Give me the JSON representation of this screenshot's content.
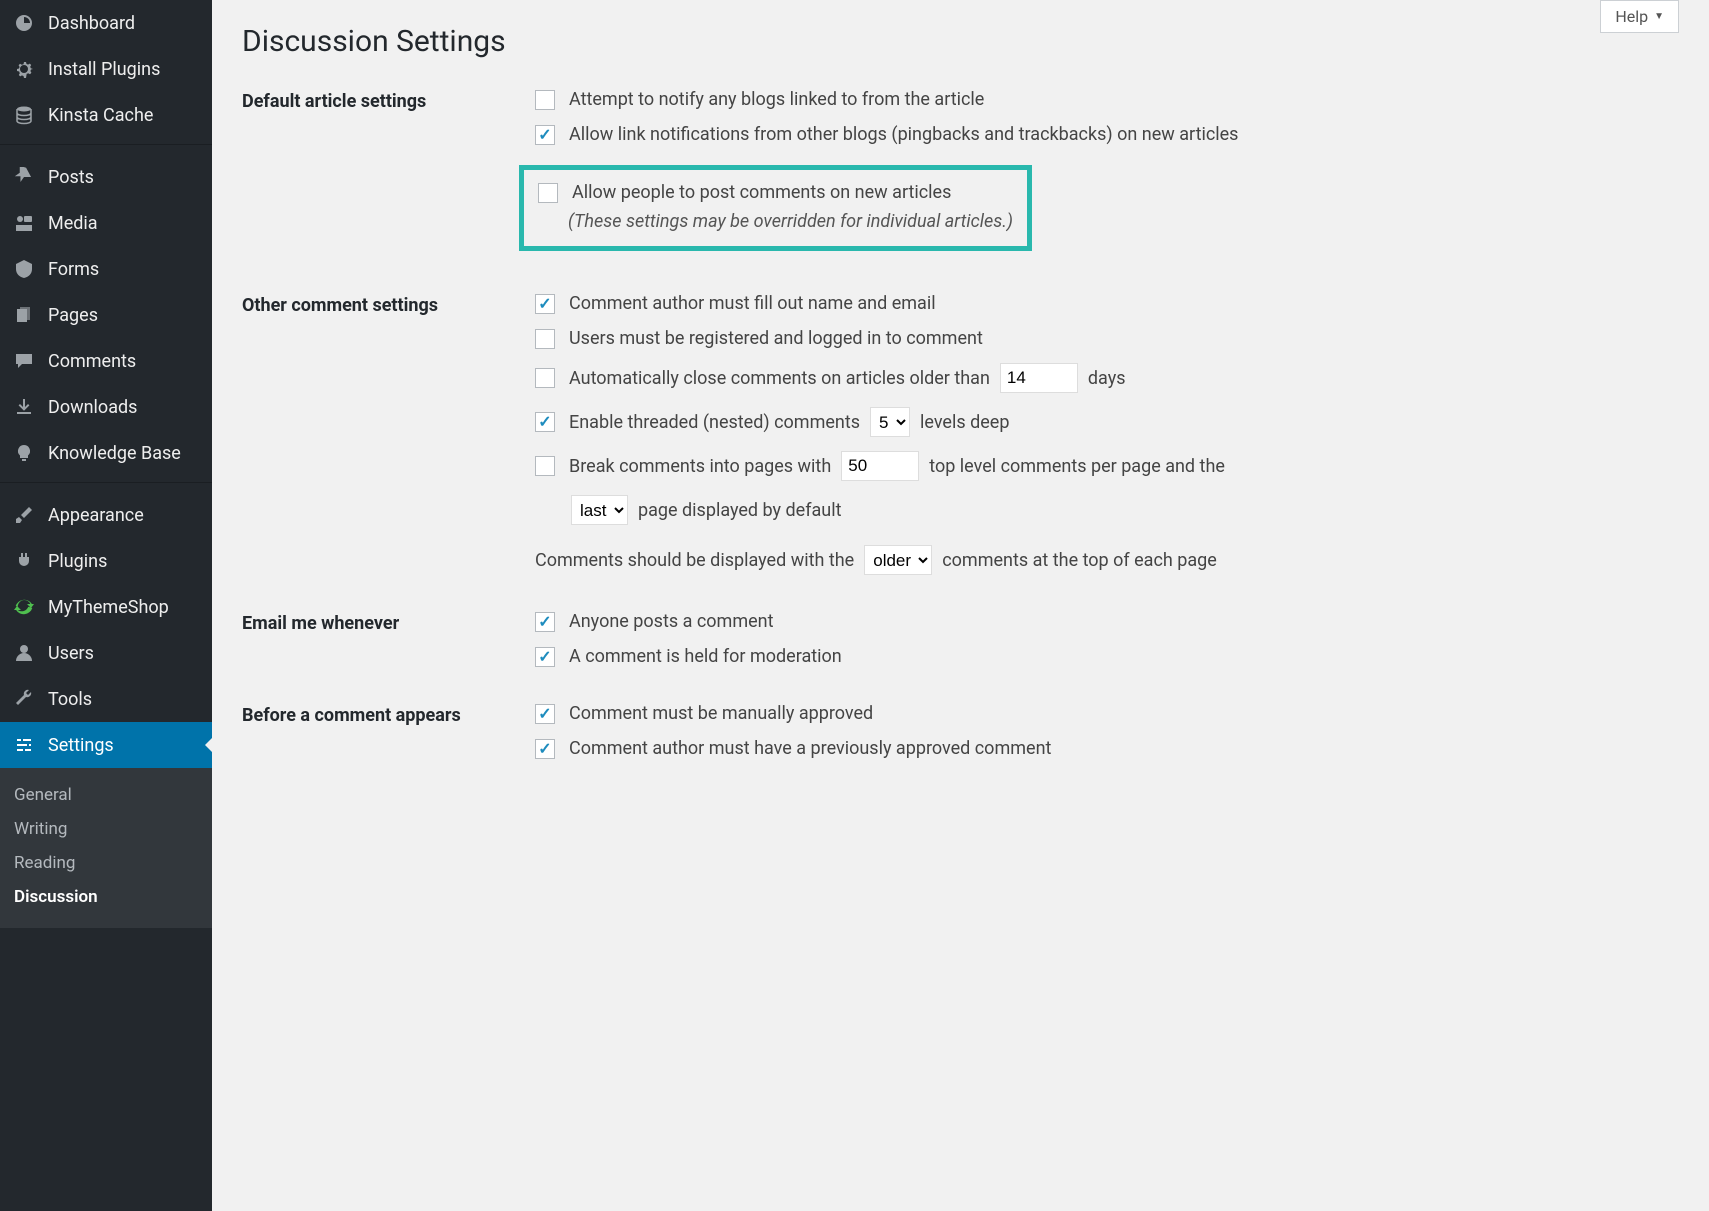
{
  "help_label": "Help",
  "page_title": "Discussion Settings",
  "sidebar": {
    "items": [
      {
        "label": "Dashboard"
      },
      {
        "label": "Install Plugins"
      },
      {
        "label": "Kinsta Cache"
      },
      {
        "label": "Posts"
      },
      {
        "label": "Media"
      },
      {
        "label": "Forms"
      },
      {
        "label": "Pages"
      },
      {
        "label": "Comments"
      },
      {
        "label": "Downloads"
      },
      {
        "label": "Knowledge Base"
      },
      {
        "label": "Appearance"
      },
      {
        "label": "Plugins"
      },
      {
        "label": "MyThemeShop"
      },
      {
        "label": "Users"
      },
      {
        "label": "Tools"
      },
      {
        "label": "Settings"
      }
    ],
    "submenu": [
      {
        "label": "General"
      },
      {
        "label": "Writing"
      },
      {
        "label": "Reading"
      },
      {
        "label": "Discussion"
      }
    ]
  },
  "sections": {
    "default_article": {
      "heading": "Default article settings",
      "opt1": "Attempt to notify any blogs linked to from the article",
      "opt2": "Allow link notifications from other blogs (pingbacks and trackbacks) on new articles",
      "opt3": "Allow people to post comments on new articles",
      "note": "(These settings may be overridden for individual articles.)"
    },
    "other_comment": {
      "heading": "Other comment settings",
      "opt1": "Comment author must fill out name and email",
      "opt2": "Users must be registered and logged in to comment",
      "opt3a": "Automatically close comments on articles older than",
      "opt3_val": "14",
      "opt3b": "days",
      "opt4a": "Enable threaded (nested) comments",
      "opt4_val": "5",
      "opt4b": "levels deep",
      "opt5a": "Break comments into pages with",
      "opt5_val": "50",
      "opt5b": "top level comments per page and the",
      "opt5_sel": "last",
      "opt5c": "page displayed by default",
      "opt6a": "Comments should be displayed with the",
      "opt6_sel": "older",
      "opt6b": "comments at the top of each page"
    },
    "email_me": {
      "heading": "Email me whenever",
      "opt1": "Anyone posts a comment",
      "opt2": "A comment is held for moderation"
    },
    "before_appears": {
      "heading": "Before a comment appears",
      "opt1": "Comment must be manually approved",
      "opt2": "Comment author must have a previously approved comment"
    }
  }
}
